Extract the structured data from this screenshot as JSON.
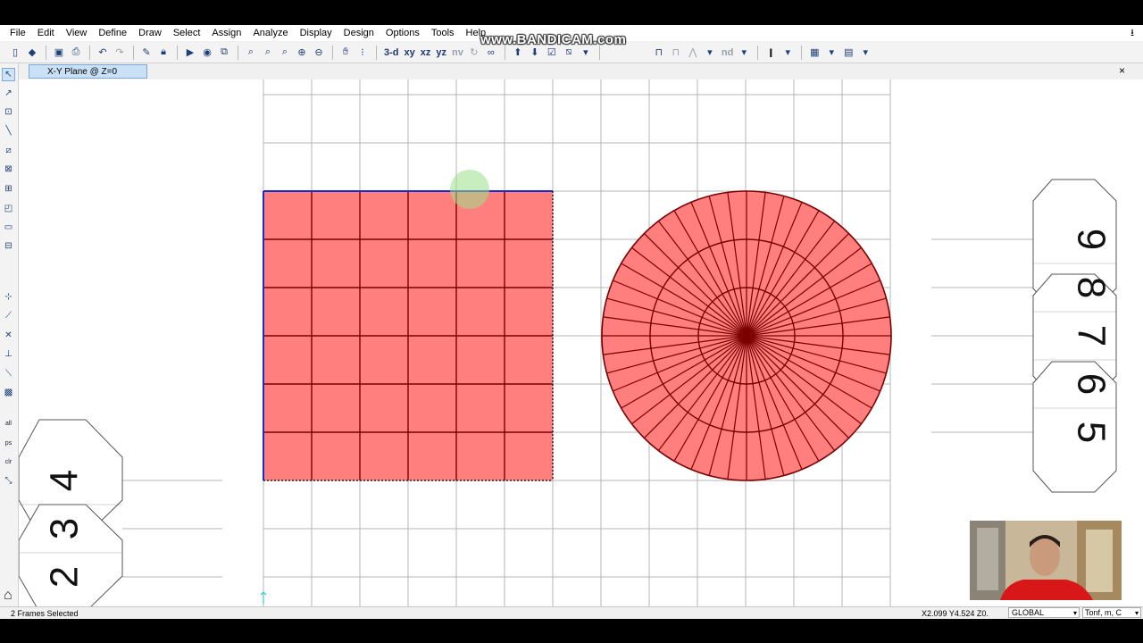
{
  "watermark": "www.BANDICAM.com",
  "menu": [
    "File",
    "Edit",
    "View",
    "Define",
    "Draw",
    "Select",
    "Assign",
    "Analyze",
    "Display",
    "Design",
    "Options",
    "Tools",
    "Help"
  ],
  "toolbar": {
    "view_3d": "3-d",
    "view_xy": "xy",
    "view_xz": "xz",
    "view_yz": "yz",
    "view_nv": "nv",
    "view_nd": "nd"
  },
  "tab": {
    "title": "X-Y Plane @ Z=0",
    "close_label": "×"
  },
  "grid_labels": {
    "left": [
      "4",
      "3",
      "2"
    ],
    "right": [
      "9",
      "8",
      "7",
      "6",
      "5"
    ]
  },
  "status": {
    "selection": "2 Frames Selected",
    "coordinates": "X2.099  Y4.524  Z0.",
    "coord_system": "GLOBAL",
    "units": "Tonf, m, C"
  },
  "colors": {
    "area_fill": "#ff7f7f",
    "area_edge": "#7a0000",
    "selected_edge": "#1a2ad1",
    "grid": "#b4b4b4"
  }
}
